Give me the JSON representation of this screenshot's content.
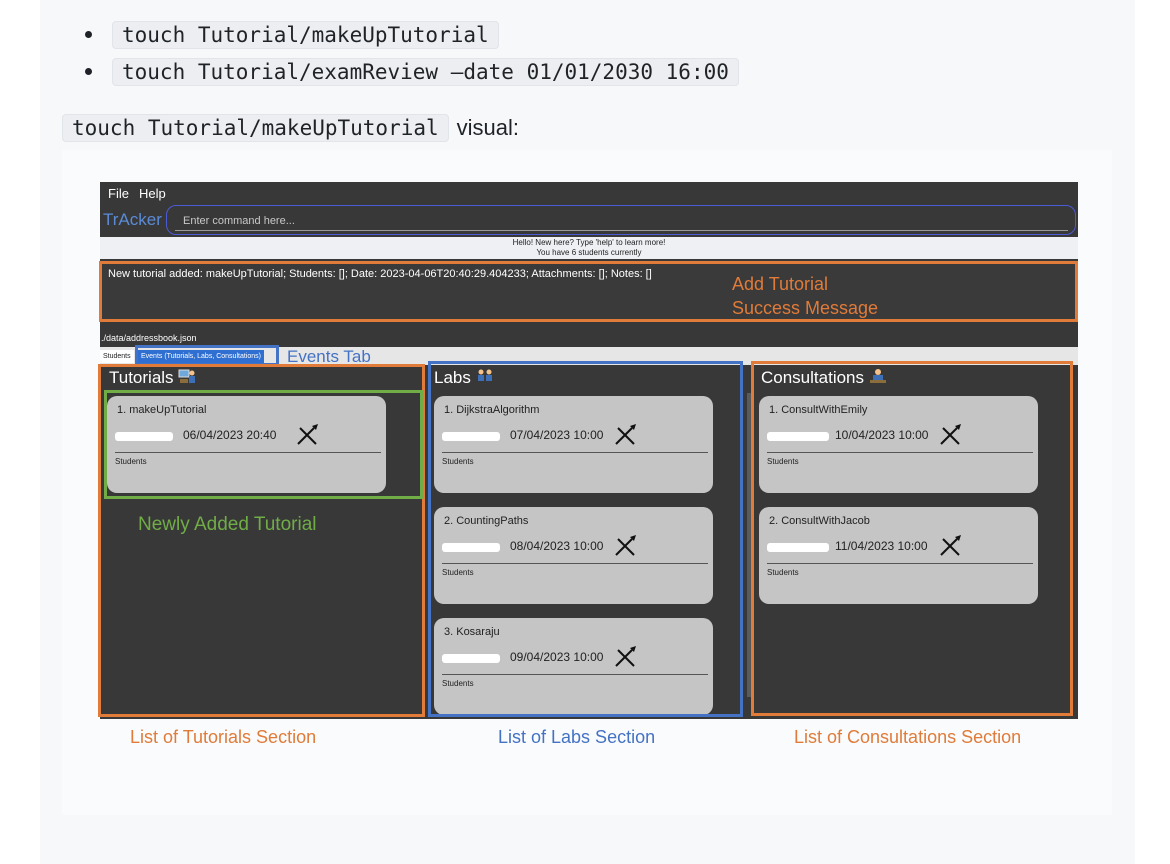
{
  "doc": {
    "bullets": [
      "touch Tutorial/makeUpTutorial",
      "touch Tutorial/examReview —date 01/01/2030 16:00"
    ],
    "visual_code": "touch Tutorial/makeUpTutorial",
    "visual_suffix": "visual:"
  },
  "app": {
    "menu": [
      "File",
      "Help"
    ],
    "brand": "TrAcker",
    "command_placeholder": "Enter command here...",
    "welcome_line1": "Hello! New here? Type 'help' to learn more!",
    "welcome_line2": "You have 6 students currently",
    "result_message": "New tutorial added: makeUpTutorial; Students: []; Date: 2023-04-06T20:40:29.404233; Attachments: []; Notes: []",
    "path": "./data/addressbook.json",
    "tabs": [
      "Students",
      "Events (Tutorials, Labs, Consultations)"
    ],
    "columns": {
      "tutorials": {
        "title": "Tutorials",
        "icon": "tutorial-icon",
        "cards": [
          {
            "name": "1. makeUpTutorial",
            "date": "06/04/2023 20:40",
            "students": "Students"
          }
        ]
      },
      "labs": {
        "title": "Labs",
        "icon": "lab-icon",
        "cards": [
          {
            "name": "1. DijkstraAlgorithm",
            "date": "07/04/2023 10:00",
            "students": "Students"
          },
          {
            "name": "2. CountingPaths",
            "date": "08/04/2023 10:00",
            "students": "Students"
          },
          {
            "name": "3. Kosaraju",
            "date": "09/04/2023 10:00",
            "students": "Students"
          }
        ]
      },
      "consultations": {
        "title": "Consultations",
        "icon": "consultation-icon",
        "cards": [
          {
            "name": "1. ConsultWithEmily",
            "date": "10/04/2023 10:00",
            "students": "Students"
          },
          {
            "name": "2. ConsultWithJacob",
            "date": "11/04/2023 10:00",
            "students": "Students"
          }
        ]
      }
    }
  },
  "annotations": {
    "add_tutorial_line1": "Add Tutorial",
    "add_tutorial_line2": "Success Message",
    "events_tab": "Events Tab",
    "newly_added": "Newly Added Tutorial",
    "tutorials_section": "List of Tutorials Section",
    "labs_section": "List of Labs Section",
    "consultations_section": "List of Consultations Section"
  },
  "colors": {
    "orange": "#e07b39",
    "blue": "#4472c4",
    "green": "#70ad47",
    "app_bg": "#383838",
    "card_bg": "#c5c5c5"
  }
}
